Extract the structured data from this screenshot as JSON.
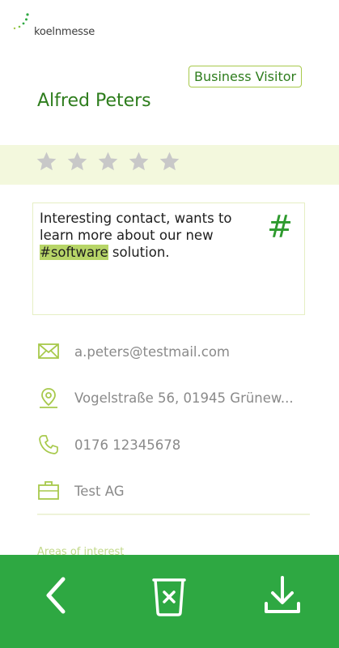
{
  "header": {
    "logo_text": "koelnmesse"
  },
  "contact": {
    "badge": "Business Visitor",
    "name": "Alfred Peters",
    "rating": 0,
    "rating_max": 5
  },
  "note": {
    "line1": "Interesting contact, wants to learn more about our new ",
    "hashtag": "#software",
    "line2": " solution.",
    "hash_icon": "hashtag-icon"
  },
  "details": {
    "email": "a.peters@testmail.com",
    "address": "Vogelstraße 56, 01945 Grünew...",
    "phone": "0176 12345678",
    "company": "Test AG"
  },
  "sections": {
    "areas_of_interest": "Areas of interest"
  },
  "bottom_bar": {
    "back": "chevron-left-icon",
    "delete": "trash-icon",
    "download": "download-icon"
  },
  "colors": {
    "brand_green": "#2ea842",
    "text_green": "#2e7d1d",
    "accent_lime": "#a7c94b",
    "band": "#f3f8dd",
    "star_gray": "#c8c8c8"
  }
}
